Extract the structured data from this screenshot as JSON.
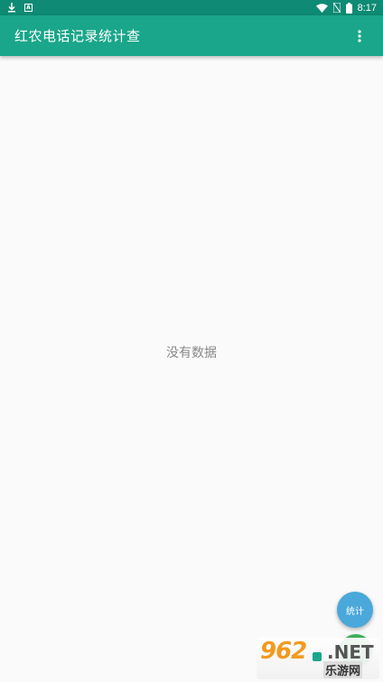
{
  "status_bar": {
    "time": "8:17",
    "left_icons": [
      "download-icon",
      "a-notification-icon"
    ],
    "right_icons": [
      "wifi-icon",
      "no-sim-icon",
      "battery-icon"
    ]
  },
  "app_bar": {
    "title": "红农电话记录统计查",
    "overflow_icon": "more-vert-icon",
    "background": "#1aa68a"
  },
  "content": {
    "empty_message": "没有数据"
  },
  "fab": {
    "stats_label": "统计",
    "stats_color": "#4aa8da",
    "secondary_color": "#3fae5a"
  },
  "watermark": {
    "number": "962",
    "suffix": ".NET",
    "site_name": "乐游网"
  }
}
